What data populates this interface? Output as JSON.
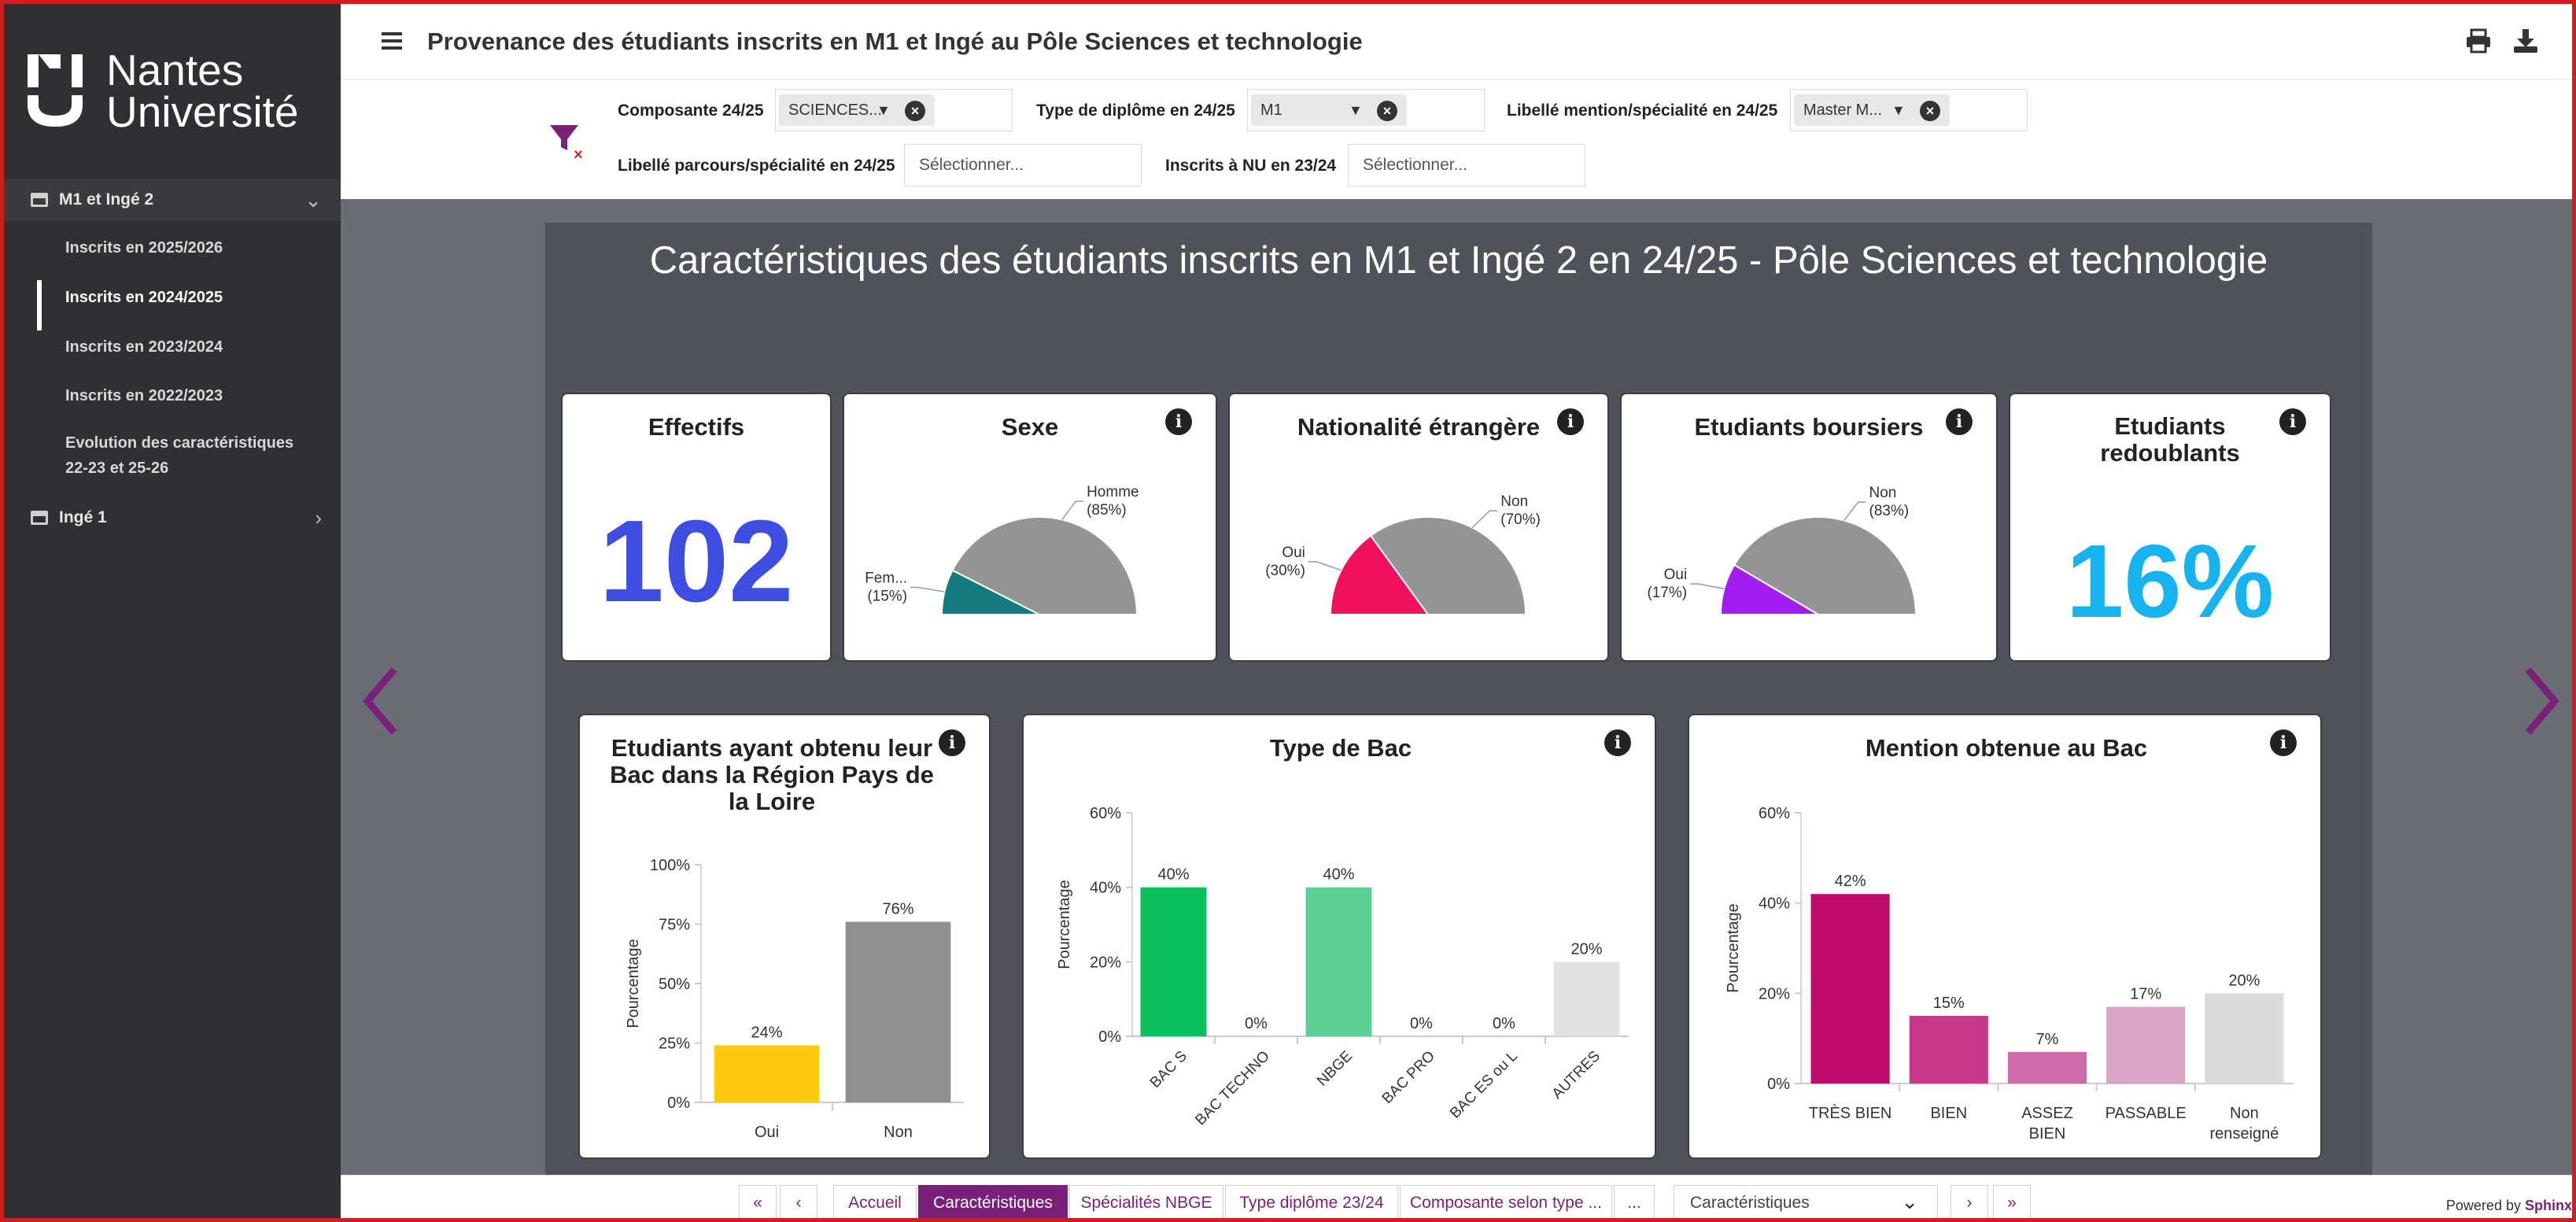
{
  "app": {
    "logo_line1": "Nantes",
    "logo_line2": "Université",
    "page_title": "Provenance des étudiants inscrits en M1 et Ingé au Pôle Sciences et technologie"
  },
  "sidebar": {
    "groups": [
      {
        "label": "M1 et Ingé 2",
        "expanded": true
      },
      {
        "label": "Ingé 1",
        "expanded": false
      }
    ],
    "items": [
      {
        "label": "Inscrits en 2025/2026",
        "active": false
      },
      {
        "label": "Inscrits en 2024/2025",
        "active": true
      },
      {
        "label": "Inscrits en 2023/2024",
        "active": false
      },
      {
        "label": "Inscrits en 2022/2023",
        "active": false
      },
      {
        "label_line1": "Evolution des caractéristiques",
        "label_line2": "22-23 et 25-26",
        "active": false
      }
    ]
  },
  "filters": {
    "composante": {
      "label": "Composante 24/25",
      "value": "SCIENCES..."
    },
    "type_diplome": {
      "label": "Type de diplôme en 24/25",
      "value": "M1"
    },
    "mention": {
      "label": "Libellé mention/spécialité en 24/25",
      "value": "Master M..."
    },
    "parcours": {
      "label": "Libellé parcours/spécialité en 24/25",
      "placeholder": "Sélectionner..."
    },
    "inscrits": {
      "label": "Inscrits à NU en 23/24",
      "placeholder": "Sélectionner..."
    }
  },
  "board": {
    "title": "Caractéristiques des étudiants inscrits en M1 et Ingé 2 en 24/25 - Pôle Sciences et technologie"
  },
  "kpis": {
    "effectifs": {
      "title": "Effectifs",
      "value": "102",
      "color": "#3d4ee0"
    },
    "redoublants": {
      "title_line1": "Etudiants",
      "title_line2": "redoublants",
      "value": "16%",
      "color": "#16b3f0"
    }
  },
  "chart_data": [
    {
      "type": "pie",
      "title": "Sexe",
      "variant": "half-donut",
      "slices": [
        {
          "label": "Fem...",
          "value": 15,
          "text": "(15%)",
          "color": "#137a80"
        },
        {
          "label": "Homme",
          "value": 85,
          "text": "(85%)",
          "color": "#949494"
        }
      ]
    },
    {
      "type": "pie",
      "title": "Nationalité étrangère",
      "variant": "half-donut",
      "slices": [
        {
          "label": "Oui",
          "value": 30,
          "text": "(30%)",
          "color": "#f0105e"
        },
        {
          "label": "Non",
          "value": 70,
          "text": "(70%)",
          "color": "#949494"
        }
      ]
    },
    {
      "type": "pie",
      "title": "Etudiants boursiers",
      "variant": "half-donut",
      "slices": [
        {
          "label": "Oui",
          "value": 17,
          "text": "(17%)",
          "color": "#a21df0"
        },
        {
          "label": "Non",
          "value": 83,
          "text": "(83%)",
          "color": "#949494"
        }
      ]
    },
    {
      "type": "bar",
      "title_lines": [
        "Etudiants ayant obtenu leur",
        "Bac dans la Région Pays de",
        "la Loire"
      ],
      "categories": [
        "Oui",
        "Non"
      ],
      "values": [
        24,
        76
      ],
      "labels": [
        "24%",
        "76%"
      ],
      "colors": [
        "#ffc90e",
        "#8f8f8f"
      ],
      "ylabel": "Pourcentage",
      "ylim": [
        0,
        100
      ],
      "yticks": [
        "0%",
        "25%",
        "50%",
        "75%",
        "100%"
      ],
      "ytick_values": [
        0,
        25,
        50,
        75,
        100
      ],
      "rotate_labels": false
    },
    {
      "type": "bar",
      "title_lines": [
        "Type de Bac"
      ],
      "categories": [
        "BAC S",
        "BAC TECHNO",
        "NBGE",
        "BAC PRO",
        "BAC ES ou L",
        "AUTRES"
      ],
      "values": [
        40,
        0,
        40,
        0,
        0,
        20
      ],
      "labels": [
        "40%",
        "0%",
        "40%",
        "0%",
        "0%",
        "20%"
      ],
      "colors": [
        "#0bbf5a",
        "#0bbf5a",
        "#5ccf95",
        "#5ccf95",
        "#5ccf95",
        "#e2e2e2"
      ],
      "ylabel": "Pourcentage",
      "ylim": [
        0,
        60
      ],
      "yticks": [
        "0%",
        "20%",
        "40%",
        "60%"
      ],
      "ytick_values": [
        0,
        20,
        40,
        60
      ],
      "rotate_labels": true
    },
    {
      "type": "bar",
      "title_lines": [
        "Mention obtenue au Bac"
      ],
      "categories": [
        "TRÈS BIEN",
        "BIEN",
        "ASSEZ BIEN",
        "PASSABLE",
        "Non renseigné"
      ],
      "category_lines": [
        [
          "TRÈS BIEN"
        ],
        [
          "BIEN"
        ],
        [
          "ASSEZ",
          "BIEN"
        ],
        [
          "PASSABLE"
        ],
        [
          "Non",
          "renseigné"
        ]
      ],
      "values": [
        42,
        15,
        7,
        17,
        20
      ],
      "labels": [
        "42%",
        "15%",
        "7%",
        "17%",
        "20%"
      ],
      "colors": [
        "#bf0a6e",
        "#c8388c",
        "#cf6aaa",
        "#d9a3c5",
        "#dadada"
      ],
      "ylabel": "Pourcentage",
      "ylim": [
        0,
        60
      ],
      "yticks": [
        "0%",
        "20%",
        "40%",
        "60%"
      ],
      "ytick_values": [
        0,
        20,
        40,
        60
      ],
      "rotate_labels": false
    }
  ],
  "pager": {
    "first": "«",
    "prev": "‹",
    "tabs": [
      "Accueil",
      "Caractéristiques",
      "Spécialités NBGE",
      "Type diplôme 23/24",
      "Composante selon type ...",
      "..."
    ],
    "active_tab": "Caractéristiques",
    "select_value": "Caractéristiques",
    "next": "›",
    "last": "»",
    "powered_prefix": "Powered by",
    "powered_brand": "Sphinx"
  },
  "colors": {
    "accent": "#7a1f7a",
    "sidebar_bg": "#2f3033",
    "board_bg": "#4f525a"
  }
}
